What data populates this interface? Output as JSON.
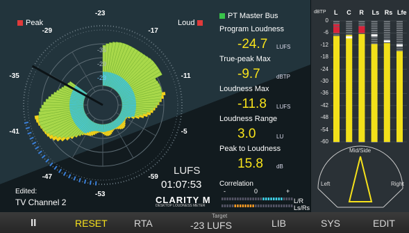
{
  "radar": {
    "peak_label": "Peak",
    "loud_label": "Loud",
    "outer_ticks": [
      "-23",
      "-17",
      "-11",
      "-5",
      "-59",
      "-53",
      "-47",
      "-41",
      "-35",
      "-29"
    ],
    "inner_ticks": [
      "-23",
      "-29",
      "-35"
    ],
    "unit": "LUFS",
    "time": "01:07:53",
    "brand": "CLARITY M",
    "brand_sub": "DESKTOP LOUDNESS METER",
    "edited_label": "Edited:",
    "preset": "TV Channel 2",
    "colors": {
      "green": "#a8d84a",
      "cyan": "#39c3e0",
      "yellow": "#f2d21b",
      "blue": "#3a7fd8"
    }
  },
  "stats": {
    "bus": "PT Master Bus",
    "items": [
      {
        "label": "Program Loudness",
        "value": "-24.7",
        "unit": "LUFS"
      },
      {
        "label": "True-peak Max",
        "value": "-9.7",
        "unit": "dBTP"
      },
      {
        "label": "Loudness Max",
        "value": "-11.8",
        "unit": "LUFS"
      },
      {
        "label": "Loudness Range",
        "value": "3.0",
        "unit": "LU"
      },
      {
        "label": "Peak to Loudness",
        "value": "15.8",
        "unit": "dB"
      }
    ],
    "correlation_label": "Correlation",
    "corr_minus": "-",
    "corr_zero": "0",
    "corr_plus": "+",
    "corr_lr": "L/R",
    "corr_lsrs": "Ls/Rs"
  },
  "meter": {
    "unit_label": "dBTP",
    "channels": [
      "L",
      "C",
      "R",
      "Ls",
      "Rs",
      "Lfe"
    ],
    "scale": [
      "0",
      "-6",
      "-12",
      "-18",
      "-24",
      "-30",
      "-36",
      "-42",
      "-48",
      "-54",
      "-60"
    ],
    "levels_dbtp": [
      -7.5,
      -7,
      -6.5,
      -11.5,
      -11,
      -15
    ],
    "peaks_dbtp": [
      -2,
      -8,
      -3,
      -7,
      -10,
      -12
    ],
    "midside_title": "Mid/Side",
    "left_label": "Left",
    "right_label": "Right",
    "colors": {
      "bar": "#f2e01a",
      "clip": "#d8233a",
      "empty": "#6d7378"
    }
  },
  "toolbar": {
    "pause": "II",
    "reset": "RESET",
    "rta": "RTA",
    "target_caption": "Target",
    "target_value": "-23 LUFS",
    "lib": "LIB",
    "sys": "SYS",
    "edit": "EDIT"
  }
}
